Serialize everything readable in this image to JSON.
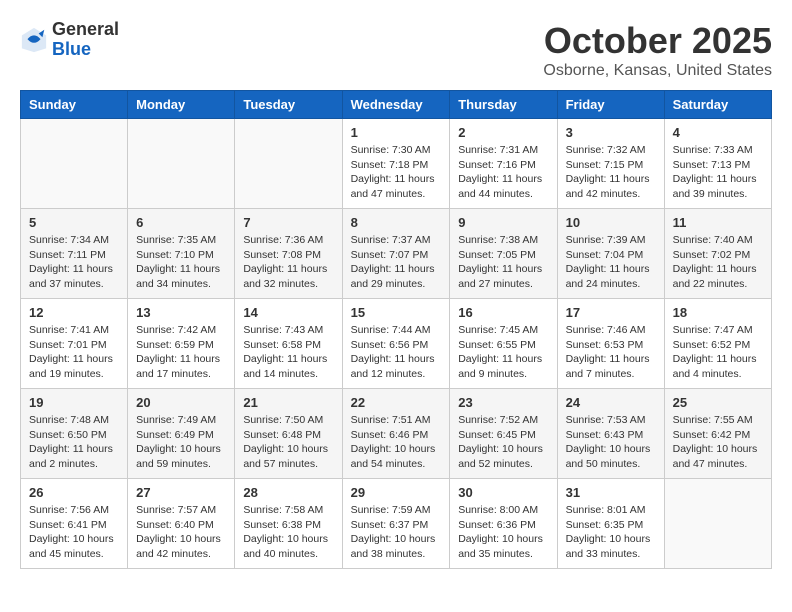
{
  "logo": {
    "general": "General",
    "blue": "Blue"
  },
  "title": "October 2025",
  "location": "Osborne, Kansas, United States",
  "weekdays": [
    "Sunday",
    "Monday",
    "Tuesday",
    "Wednesday",
    "Thursday",
    "Friday",
    "Saturday"
  ],
  "weeks": [
    [
      {
        "day": "",
        "info": ""
      },
      {
        "day": "",
        "info": ""
      },
      {
        "day": "",
        "info": ""
      },
      {
        "day": "1",
        "info": "Sunrise: 7:30 AM\nSunset: 7:18 PM\nDaylight: 11 hours\nand 47 minutes."
      },
      {
        "day": "2",
        "info": "Sunrise: 7:31 AM\nSunset: 7:16 PM\nDaylight: 11 hours\nand 44 minutes."
      },
      {
        "day": "3",
        "info": "Sunrise: 7:32 AM\nSunset: 7:15 PM\nDaylight: 11 hours\nand 42 minutes."
      },
      {
        "day": "4",
        "info": "Sunrise: 7:33 AM\nSunset: 7:13 PM\nDaylight: 11 hours\nand 39 minutes."
      }
    ],
    [
      {
        "day": "5",
        "info": "Sunrise: 7:34 AM\nSunset: 7:11 PM\nDaylight: 11 hours\nand 37 minutes."
      },
      {
        "day": "6",
        "info": "Sunrise: 7:35 AM\nSunset: 7:10 PM\nDaylight: 11 hours\nand 34 minutes."
      },
      {
        "day": "7",
        "info": "Sunrise: 7:36 AM\nSunset: 7:08 PM\nDaylight: 11 hours\nand 32 minutes."
      },
      {
        "day": "8",
        "info": "Sunrise: 7:37 AM\nSunset: 7:07 PM\nDaylight: 11 hours\nand 29 minutes."
      },
      {
        "day": "9",
        "info": "Sunrise: 7:38 AM\nSunset: 7:05 PM\nDaylight: 11 hours\nand 27 minutes."
      },
      {
        "day": "10",
        "info": "Sunrise: 7:39 AM\nSunset: 7:04 PM\nDaylight: 11 hours\nand 24 minutes."
      },
      {
        "day": "11",
        "info": "Sunrise: 7:40 AM\nSunset: 7:02 PM\nDaylight: 11 hours\nand 22 minutes."
      }
    ],
    [
      {
        "day": "12",
        "info": "Sunrise: 7:41 AM\nSunset: 7:01 PM\nDaylight: 11 hours\nand 19 minutes."
      },
      {
        "day": "13",
        "info": "Sunrise: 7:42 AM\nSunset: 6:59 PM\nDaylight: 11 hours\nand 17 minutes."
      },
      {
        "day": "14",
        "info": "Sunrise: 7:43 AM\nSunset: 6:58 PM\nDaylight: 11 hours\nand 14 minutes."
      },
      {
        "day": "15",
        "info": "Sunrise: 7:44 AM\nSunset: 6:56 PM\nDaylight: 11 hours\nand 12 minutes."
      },
      {
        "day": "16",
        "info": "Sunrise: 7:45 AM\nSunset: 6:55 PM\nDaylight: 11 hours\nand 9 minutes."
      },
      {
        "day": "17",
        "info": "Sunrise: 7:46 AM\nSunset: 6:53 PM\nDaylight: 11 hours\nand 7 minutes."
      },
      {
        "day": "18",
        "info": "Sunrise: 7:47 AM\nSunset: 6:52 PM\nDaylight: 11 hours\nand 4 minutes."
      }
    ],
    [
      {
        "day": "19",
        "info": "Sunrise: 7:48 AM\nSunset: 6:50 PM\nDaylight: 11 hours\nand 2 minutes."
      },
      {
        "day": "20",
        "info": "Sunrise: 7:49 AM\nSunset: 6:49 PM\nDaylight: 10 hours\nand 59 minutes."
      },
      {
        "day": "21",
        "info": "Sunrise: 7:50 AM\nSunset: 6:48 PM\nDaylight: 10 hours\nand 57 minutes."
      },
      {
        "day": "22",
        "info": "Sunrise: 7:51 AM\nSunset: 6:46 PM\nDaylight: 10 hours\nand 54 minutes."
      },
      {
        "day": "23",
        "info": "Sunrise: 7:52 AM\nSunset: 6:45 PM\nDaylight: 10 hours\nand 52 minutes."
      },
      {
        "day": "24",
        "info": "Sunrise: 7:53 AM\nSunset: 6:43 PM\nDaylight: 10 hours\nand 50 minutes."
      },
      {
        "day": "25",
        "info": "Sunrise: 7:55 AM\nSunset: 6:42 PM\nDaylight: 10 hours\nand 47 minutes."
      }
    ],
    [
      {
        "day": "26",
        "info": "Sunrise: 7:56 AM\nSunset: 6:41 PM\nDaylight: 10 hours\nand 45 minutes."
      },
      {
        "day": "27",
        "info": "Sunrise: 7:57 AM\nSunset: 6:40 PM\nDaylight: 10 hours\nand 42 minutes."
      },
      {
        "day": "28",
        "info": "Sunrise: 7:58 AM\nSunset: 6:38 PM\nDaylight: 10 hours\nand 40 minutes."
      },
      {
        "day": "29",
        "info": "Sunrise: 7:59 AM\nSunset: 6:37 PM\nDaylight: 10 hours\nand 38 minutes."
      },
      {
        "day": "30",
        "info": "Sunrise: 8:00 AM\nSunset: 6:36 PM\nDaylight: 10 hours\nand 35 minutes."
      },
      {
        "day": "31",
        "info": "Sunrise: 8:01 AM\nSunset: 6:35 PM\nDaylight: 10 hours\nand 33 minutes."
      },
      {
        "day": "",
        "info": ""
      }
    ]
  ]
}
